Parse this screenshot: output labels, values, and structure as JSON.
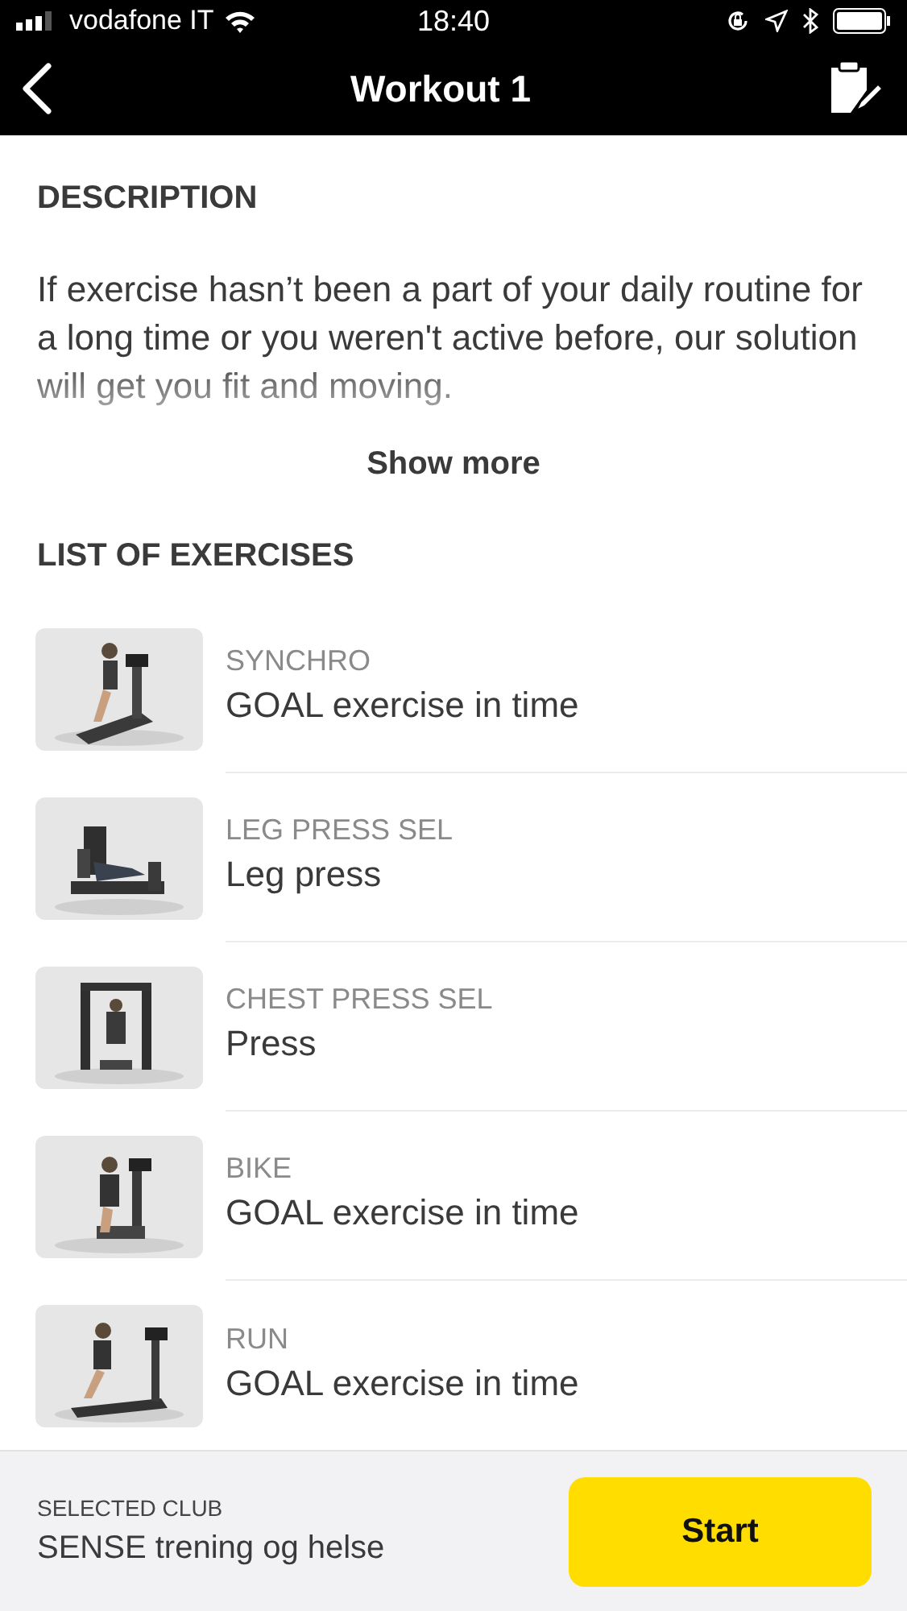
{
  "status_bar": {
    "carrier": "vodafone IT",
    "time": "18:40"
  },
  "nav": {
    "title": "Workout 1"
  },
  "description": {
    "heading": "DESCRIPTION",
    "text": "If exercise hasn’t been a part of your daily routine for a long time or you weren't active before, our solution will get you fit and moving.",
    "show_more": "Show more"
  },
  "exercises": {
    "heading": "LIST OF EXERCISES",
    "items": [
      {
        "equipment": "SYNCHRO",
        "name": "GOAL exercise in time"
      },
      {
        "equipment": "LEG PRESS SEL",
        "name": "Leg press"
      },
      {
        "equipment": "CHEST PRESS SEL",
        "name": "Press"
      },
      {
        "equipment": "BIKE",
        "name": "GOAL exercise in time"
      },
      {
        "equipment": "RUN",
        "name": "GOAL exercise in time"
      }
    ]
  },
  "footer": {
    "label": "SELECTED CLUB",
    "club": "SENSE trening og helse",
    "button": "Start"
  }
}
